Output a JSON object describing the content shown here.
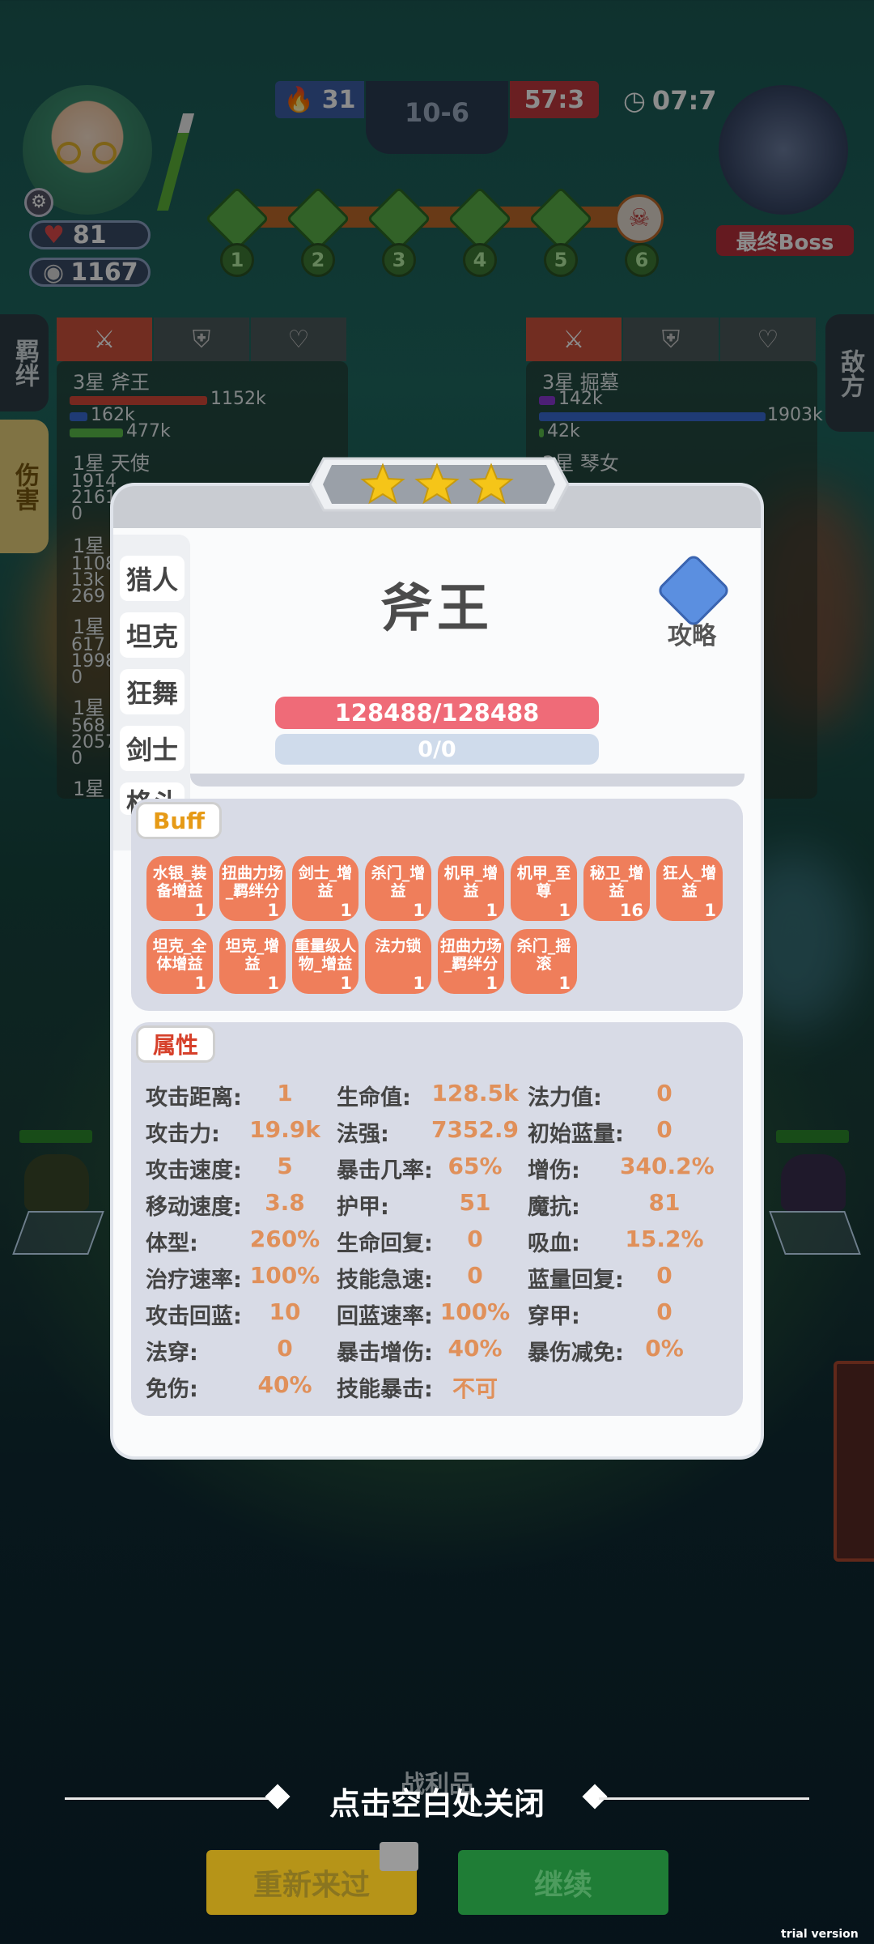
{
  "hud": {
    "left_hp": "81",
    "left_coins": "1167",
    "kills_blue": "31",
    "stage": "10-6",
    "kills_red": "57:3",
    "timer": "07:7",
    "boss_label": "最终Boss",
    "stages": [
      "1",
      "2",
      "3",
      "4",
      "5",
      "6"
    ]
  },
  "side_tabs": {
    "left_top": "羁绊",
    "left_active": "伤害",
    "right": "敌方"
  },
  "left_panel": {
    "rows": [
      {
        "name": "3星 斧王",
        "v1": "1152k",
        "v2": "162k",
        "v3": "477k"
      },
      {
        "name": "1星 天使",
        "v1": "1914",
        "v2": "2161",
        "v3": "0"
      },
      {
        "name": "1星",
        "v1": "1108",
        "v2": "13k",
        "v3": "269"
      },
      {
        "name": "1星",
        "v1": "617",
        "v2": "1998",
        "v3": "0"
      },
      {
        "name": "1星",
        "v1": "568",
        "v2": "2057",
        "v3": "0"
      },
      {
        "name": "1星",
        "v1": "",
        "v2": "",
        "v3": ""
      }
    ]
  },
  "right_panel": {
    "rows": [
      {
        "name": "3星 掘墓",
        "v1": "142k",
        "v2": "1903k",
        "v3": "42k"
      },
      {
        "name": "3星 琴女",
        "v1": "",
        "v2": "",
        "v3": ""
      }
    ]
  },
  "modal": {
    "hero_name": "斧王",
    "hp": "128488/128488",
    "mp": "0/0",
    "guide_label": "攻略",
    "classes": [
      "猎人",
      "坦克",
      "狂舞",
      "剑士",
      "格斗"
    ],
    "buff_title": "Buff",
    "buffs": [
      {
        "name": "水银_装备增益",
        "count": "1"
      },
      {
        "name": "扭曲力场_羁绊分",
        "count": "1"
      },
      {
        "name": "剑士_增益",
        "count": "1"
      },
      {
        "name": "杀门_增益",
        "count": "1"
      },
      {
        "name": "机甲_增益",
        "count": "1"
      },
      {
        "name": "机甲_至尊",
        "count": "1"
      },
      {
        "name": "秘卫_增益",
        "count": "16"
      },
      {
        "name": "狂人_增益",
        "count": "1"
      },
      {
        "name": "坦克_全体增益",
        "count": "1"
      },
      {
        "name": "坦克_增益",
        "count": "1"
      },
      {
        "name": "重量级人物_增益",
        "count": "1"
      },
      {
        "name": "法力锁",
        "count": "1"
      },
      {
        "name": "扭曲力场_羁绊分",
        "count": "1"
      },
      {
        "name": "杀门_摇滚",
        "count": "1"
      }
    ],
    "attr_title": "属性",
    "attrs": [
      [
        {
          "k": "攻击距离:",
          "v": "1"
        },
        {
          "k": "生命值:",
          "v": "128.5k"
        },
        {
          "k": "法力值:",
          "v": "0"
        }
      ],
      [
        {
          "k": "攻击力:",
          "v": "19.9k"
        },
        {
          "k": "法强:",
          "v": "7352.9"
        },
        {
          "k": "初始蓝量:",
          "v": "0"
        }
      ],
      [
        {
          "k": "攻击速度:",
          "v": "5"
        },
        {
          "k": "暴击几率:",
          "v": "65%"
        },
        {
          "k": "增伤:",
          "v": "340.2%"
        }
      ],
      [
        {
          "k": "移动速度:",
          "v": "3.8"
        },
        {
          "k": "护甲:",
          "v": "51"
        },
        {
          "k": "魔抗:",
          "v": "81"
        }
      ],
      [
        {
          "k": "体型:",
          "v": "260%"
        },
        {
          "k": "生命回复:",
          "v": "0"
        },
        {
          "k": "吸血:",
          "v": "15.2%"
        }
      ],
      [
        {
          "k": "治疗速率:",
          "v": "100%"
        },
        {
          "k": "技能急速:",
          "v": "0"
        },
        {
          "k": "蓝量回复:",
          "v": "0"
        }
      ],
      [
        {
          "k": "攻击回蓝:",
          "v": "10"
        },
        {
          "k": "回蓝速率:",
          "v": "100%"
        },
        {
          "k": "穿甲:",
          "v": "0"
        }
      ],
      [
        {
          "k": "法穿:",
          "v": "0"
        },
        {
          "k": "暴击增伤:",
          "v": "40%"
        },
        {
          "k": "暴伤减免:",
          "v": "0%"
        }
      ],
      [
        {
          "k": "免伤:",
          "v": "40%"
        },
        {
          "k": "技能暴击:",
          "v": "不可"
        }
      ]
    ]
  },
  "bottom": {
    "close_hint": "点击空白处关闭",
    "loot_label": "战利品",
    "retry_label": "重新来过",
    "continue_label": "继续",
    "watermark": "trial version"
  },
  "colors": {
    "hp_bar": "#ef6b78",
    "buff": "#ef7e5b",
    "attr_value": "#e0905a",
    "retry": "#c8a419",
    "continue": "#2fa147"
  }
}
